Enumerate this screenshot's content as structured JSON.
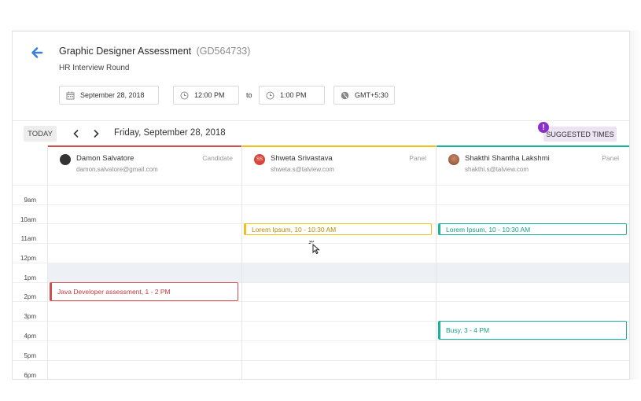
{
  "header": {
    "title": "Graphic Designer Assessment",
    "code": "(GD564733)",
    "subtitle": "HR Interview Round"
  },
  "fields": {
    "date": "September 28, 2018",
    "start_time": "12:00 PM",
    "to_label": "to",
    "end_time": "1:00 PM",
    "timezone": "GMT+5:30"
  },
  "toolbar": {
    "today_label": "TODAY",
    "current_date": "Friday, September 28, 2018",
    "suggested_label": "SUGGESTED TIMES",
    "badge": "!"
  },
  "participants": [
    {
      "name": "Damon Salvatore",
      "email": "damon.salvatore@gmail.com",
      "role": "Candidate",
      "color": "#d34d4d"
    },
    {
      "name": "Shweta Srivastava",
      "email": "shweta.s@talview.com",
      "role": "Panel",
      "initials": "SS",
      "color": "#f0c020"
    },
    {
      "name": "Shakthi Shantha Lakshmi",
      "email": "shakthi.s@talview.com",
      "role": "Panel",
      "color": "#19b39a"
    }
  ],
  "hours": [
    "9am",
    "10am",
    "11am",
    "12pm",
    "1pm",
    "2pm",
    "3pm",
    "4pm",
    "5pm",
    "6pm"
  ],
  "events": [
    {
      "title": "Lorem Ipsum,",
      "time": " 10 - 10:30 AM",
      "participant": "Shweta Srivastava"
    },
    {
      "title": "Lorem Ipsum,",
      "time": " 10 - 10:30 AM",
      "participant": "Shakthi Shantha Lakshmi"
    },
    {
      "title": "Java Developer assessment,",
      "time": " 1 - 2 PM",
      "participant": "Damon Salvatore"
    },
    {
      "title": "Busy,",
      "time": " 3 - 4 PM",
      "participant": "Shakthi Shantha Lakshmi"
    }
  ],
  "colors": {
    "back_arrow": "#3d7fd6",
    "highlight": "#edf1f6",
    "badge": "#8b2fc9"
  }
}
